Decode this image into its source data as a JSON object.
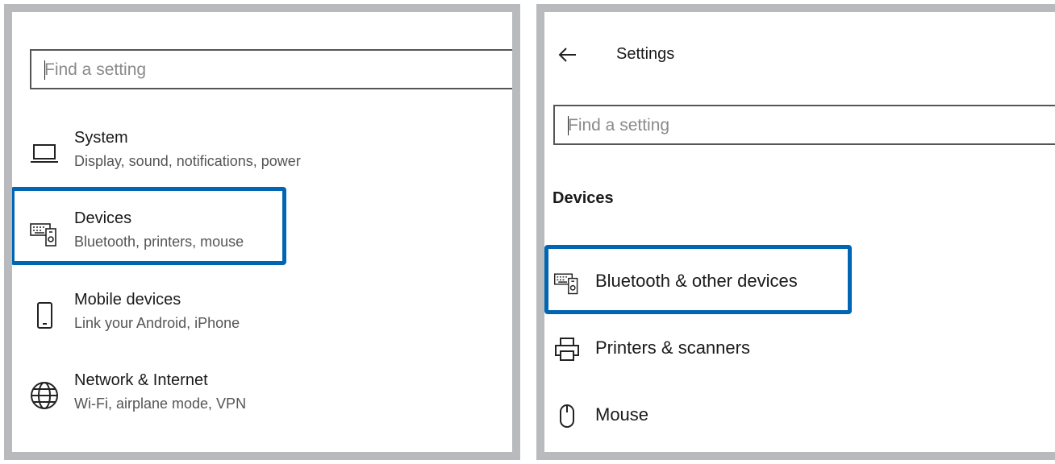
{
  "left": {
    "search": {
      "placeholder": "Find a setting"
    },
    "categories": [
      {
        "title": "System",
        "subtitle": "Display, sound, notifications, power",
        "icon": "laptop-icon"
      },
      {
        "title": "Devices",
        "subtitle": "Bluetooth, printers, mouse",
        "icon": "devices-icon",
        "highlighted": true
      },
      {
        "title": "Mobile devices",
        "subtitle": "Link your Android, iPhone",
        "icon": "phone-icon"
      },
      {
        "title": "Network & Internet",
        "subtitle": "Wi-Fi, airplane mode, VPN",
        "icon": "globe-icon"
      }
    ]
  },
  "right": {
    "title": "Settings",
    "back_icon": "back-arrow-icon",
    "search": {
      "placeholder": "Find a setting"
    },
    "section_title": "Devices",
    "items": [
      {
        "label": "Bluetooth & other devices",
        "icon": "devices-icon",
        "highlighted": true
      },
      {
        "label": "Printers & scanners",
        "icon": "printer-icon"
      },
      {
        "label": "Mouse",
        "icon": "mouse-icon"
      }
    ]
  },
  "colors": {
    "highlight": "#0066b3",
    "frame": "#b9babd"
  }
}
